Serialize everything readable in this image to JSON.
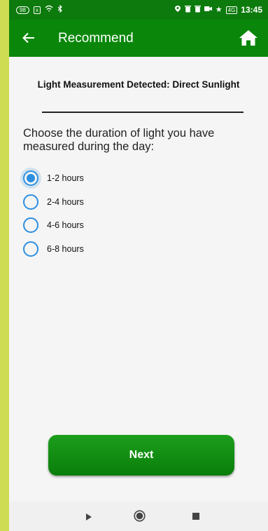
{
  "colors": {
    "status_bar": "#0c7a0c",
    "app_bar": "#0a870a",
    "radio_accent": "#2d8fe0",
    "button": "#0a870a",
    "side_strip": "#cddc52"
  },
  "status_bar": {
    "left_pill": "98",
    "left_box": "x",
    "right_box": "4G",
    "time": "13:45",
    "icons": [
      "wifi-icon",
      "bluetooth-icon",
      "location-icon",
      "delete-icon",
      "delete-icon",
      "camera-icon",
      "star-icon",
      "signal-icon"
    ]
  },
  "app_bar": {
    "title": "Recommend",
    "back_icon": "back-arrow-icon",
    "home_icon": "home-icon"
  },
  "headline": "Light Measurement Detected: Direct Sunlight",
  "question": "Choose the duration of light you have measured during the day:",
  "options": [
    {
      "label": "1-2 hours",
      "selected": true
    },
    {
      "label": "2-4 hours",
      "selected": false
    },
    {
      "label": "4-6 hours",
      "selected": false
    },
    {
      "label": "6-8 hours",
      "selected": false
    }
  ],
  "next_button": {
    "label": "Next"
  },
  "nav_bar": {
    "icons": [
      "nav-back-icon",
      "nav-home-icon",
      "nav-recent-icon"
    ]
  }
}
